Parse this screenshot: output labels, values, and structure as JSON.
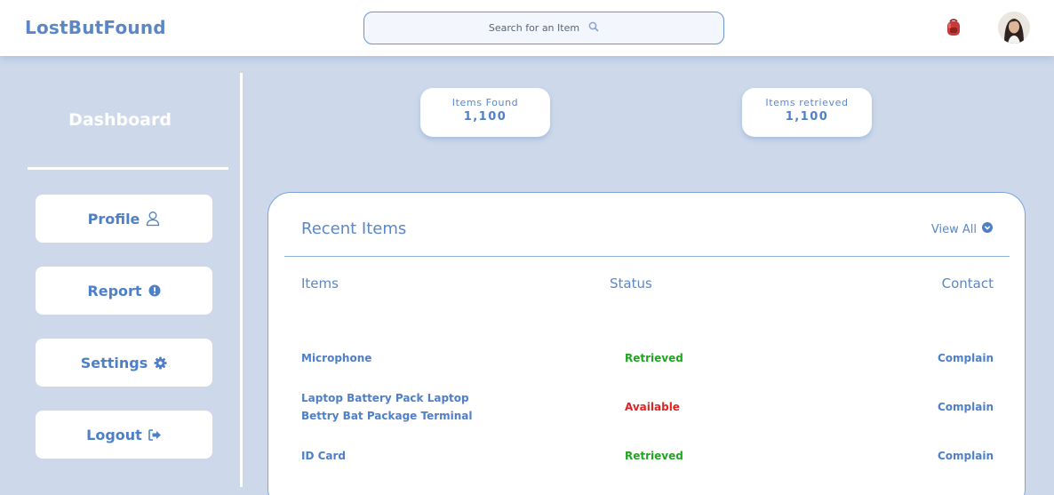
{
  "app": {
    "brand": "LostButFound"
  },
  "search": {
    "placeholder": "Search for an Item"
  },
  "sidebar": {
    "title": "Dashboard",
    "items": [
      {
        "label": "Profile",
        "icon": "user-outline-icon"
      },
      {
        "label": "Report",
        "icon": "alert-circle-icon"
      },
      {
        "label": "Settings",
        "icon": "gear-icon"
      },
      {
        "label": "Logout",
        "icon": "logout-icon"
      }
    ]
  },
  "stats": [
    {
      "label": "Items Found",
      "value": "1,100"
    },
    {
      "label": "Items retrieved",
      "value": "1,100"
    }
  ],
  "recent": {
    "title": "Recent Items",
    "view_all": "View All",
    "columns": [
      "Items",
      "Status",
      "Contact"
    ],
    "rows": [
      {
        "item": "Microphone",
        "status": "Retrieved",
        "status_color": "#1fa61f",
        "contact": "Complain"
      },
      {
        "item": "Laptop Battery Pack Laptop Bettry Bat Package Terminal",
        "item_line1": "Laptop Battery Pack Laptop",
        "item_line2": "Bettry Bat Package Terminal",
        "status": "Available",
        "status_color": "#e02424",
        "contact": "Complain"
      },
      {
        "item": "ID Card",
        "status": "Retrieved",
        "status_color": "#1fa61f",
        "contact": "Complain"
      }
    ]
  },
  "colors": {
    "accent": "#5b87c7",
    "background": "#cdd8ea",
    "retrieved": "#1fa61f",
    "available": "#e02424"
  }
}
